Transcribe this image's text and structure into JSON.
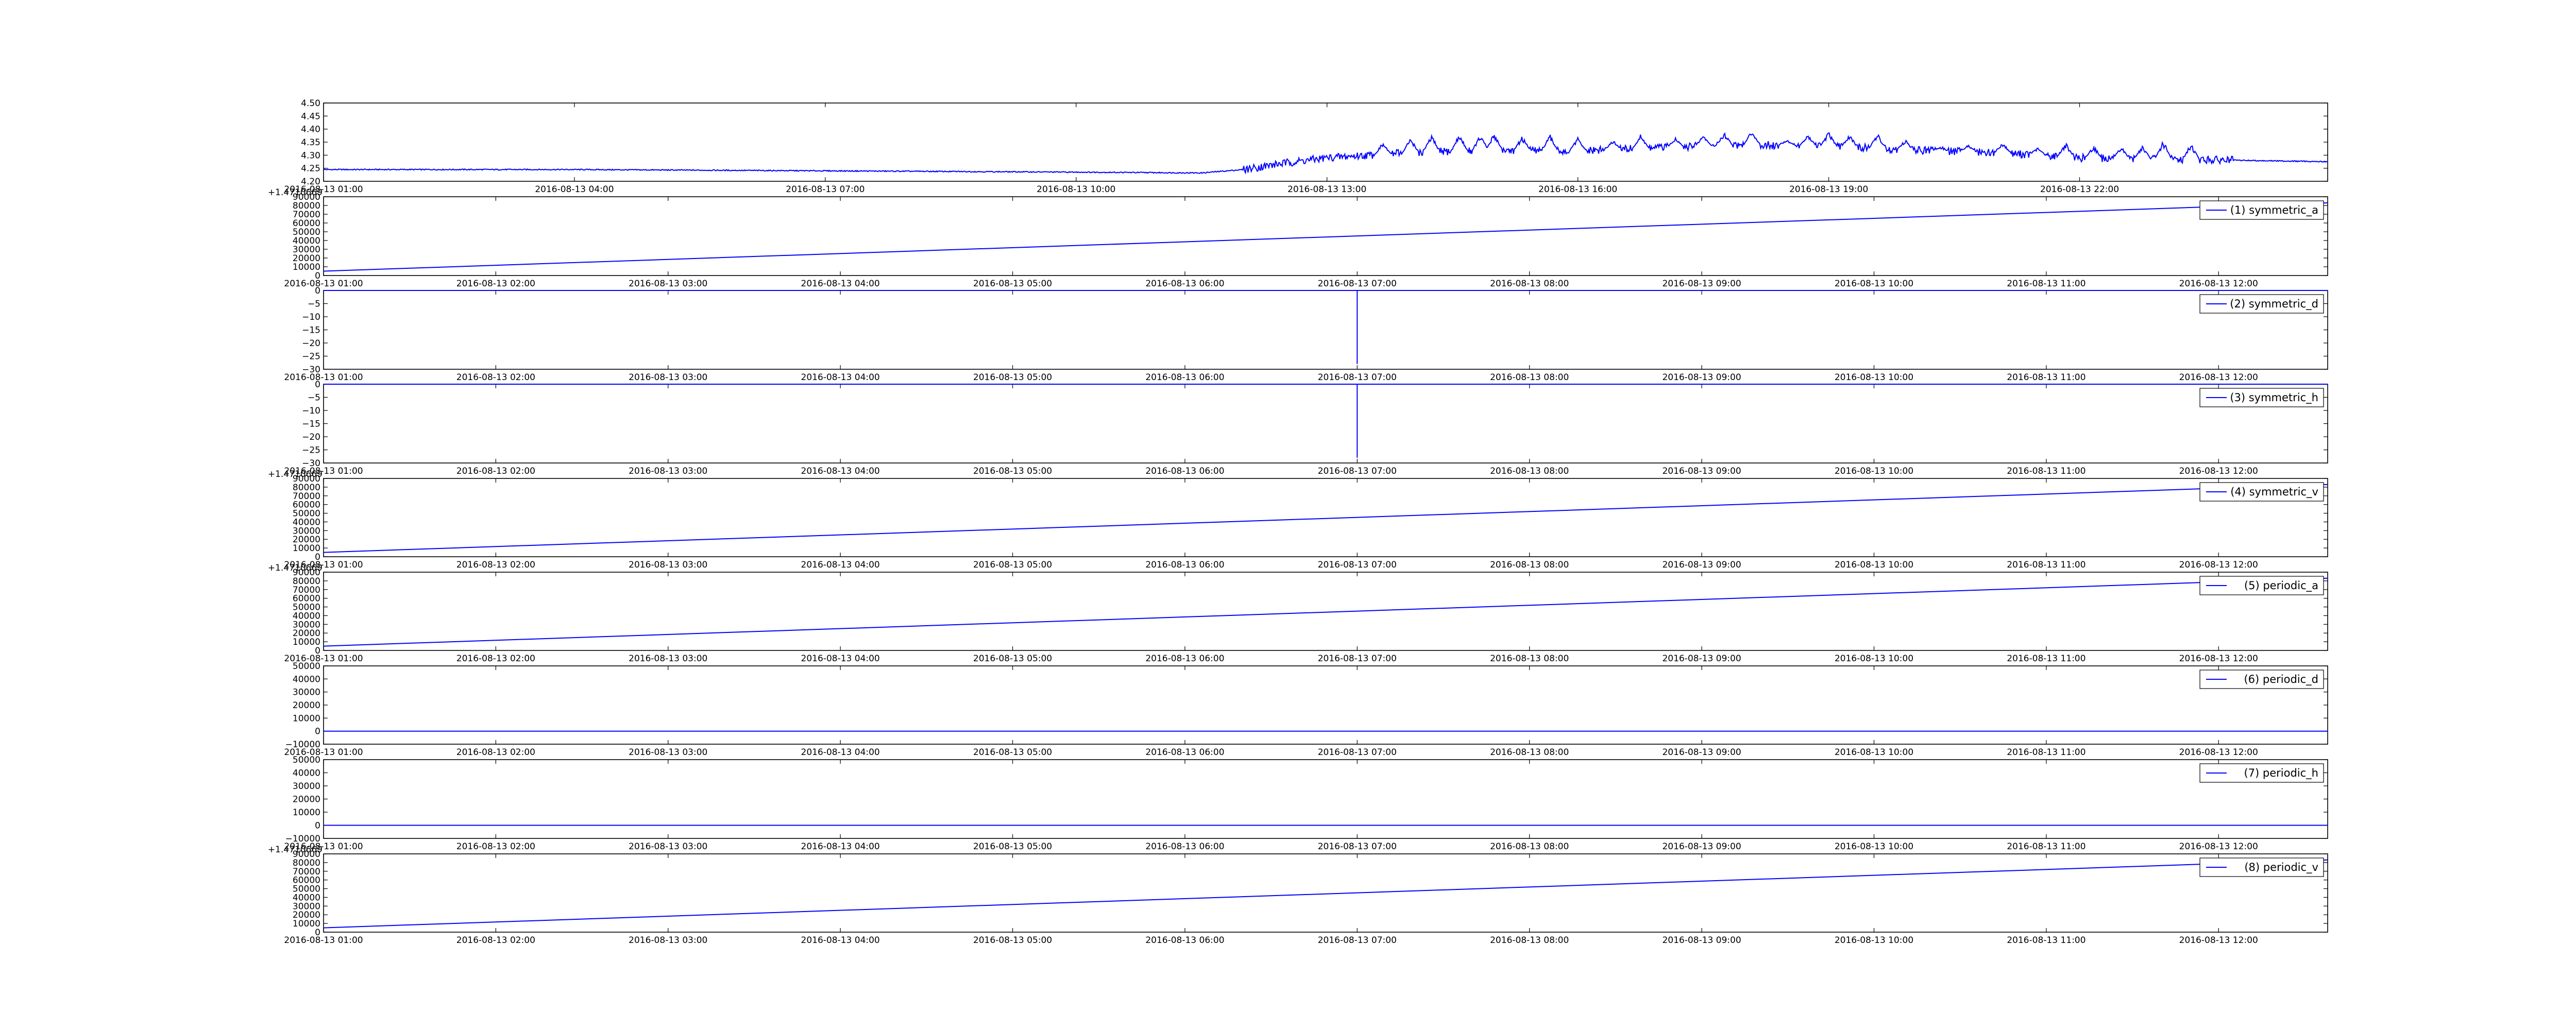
{
  "figure": {
    "background": "#ffffff",
    "line_color": "#0000ff"
  },
  "chart_data": [
    {
      "type": "line",
      "xlabel": "",
      "ylabel": "",
      "ylim": [
        4.2,
        4.5
      ],
      "y_ticks": [
        "4.20",
        "4.25",
        "4.30",
        "4.35",
        "4.40",
        "4.45",
        "4.50"
      ],
      "xlim": [
        "2016-08-13 01:00",
        "2016-08-14 00:58"
      ],
      "x_ticks": [
        "2016-08-13 01:00",
        "2016-08-13 04:00",
        "2016-08-13 07:00",
        "2016-08-13 10:00",
        "2016-08-13 13:00",
        "2016-08-13 16:00",
        "2016-08-13 19:00",
        "2016-08-13 22:00"
      ],
      "y_offset_text": "",
      "legend": null,
      "baseline": [
        [
          "2016-08-13 01:00",
          4.245
        ],
        [
          "2016-08-13 04:00",
          4.245
        ],
        [
          "2016-08-13 07:00",
          4.24
        ],
        [
          "2016-08-13 10:00",
          4.235
        ],
        [
          "2016-08-13 11:30",
          4.232
        ],
        [
          "2016-08-13 12:00",
          4.245
        ],
        [
          "2016-08-13 12:30",
          4.27
        ],
        [
          "2016-08-13 13:00",
          4.29
        ],
        [
          "2016-08-13 14:00",
          4.31
        ],
        [
          "2016-08-13 15:00",
          4.32
        ],
        [
          "2016-08-13 16:00",
          4.315
        ],
        [
          "2016-08-13 17:00",
          4.33
        ],
        [
          "2016-08-13 18:00",
          4.34
        ],
        [
          "2016-08-13 19:00",
          4.335
        ],
        [
          "2016-08-13 20:00",
          4.32
        ],
        [
          "2016-08-13 21:00",
          4.31
        ],
        [
          "2016-08-13 22:00",
          4.29
        ],
        [
          "2016-08-14 00:58",
          4.275
        ]
      ],
      "spikes": [
        [
          "2016-08-13 13:40",
          4.35
        ],
        [
          "2016-08-13 14:00",
          4.37
        ],
        [
          "2016-08-13 14:15",
          4.38
        ],
        [
          "2016-08-13 14:35",
          4.385
        ],
        [
          "2016-08-13 14:50",
          4.38
        ],
        [
          "2016-08-13 15:00",
          4.39
        ],
        [
          "2016-08-13 15:20",
          4.375
        ],
        [
          "2016-08-13 15:40",
          4.38
        ],
        [
          "2016-08-13 16:00",
          4.37
        ],
        [
          "2016-08-13 16:25",
          4.36
        ],
        [
          "2016-08-13 16:45",
          4.38
        ],
        [
          "2016-08-13 17:10",
          4.37
        ],
        [
          "2016-08-13 17:30",
          4.38
        ],
        [
          "2016-08-13 17:45",
          4.39
        ],
        [
          "2016-08-13 18:05",
          4.4
        ],
        [
          "2016-08-13 18:30",
          4.36
        ],
        [
          "2016-08-13 18:45",
          4.38
        ],
        [
          "2016-08-13 19:00",
          4.39
        ],
        [
          "2016-08-13 19:15",
          4.38
        ],
        [
          "2016-08-13 19:35",
          4.385
        ],
        [
          "2016-08-13 19:55",
          4.36
        ],
        [
          "2016-08-13 20:20",
          4.33
        ],
        [
          "2016-08-13 20:40",
          4.34
        ],
        [
          "2016-08-13 21:05",
          4.35
        ],
        [
          "2016-08-13 21:30",
          4.33
        ],
        [
          "2016-08-13 21:50",
          4.35
        ],
        [
          "2016-08-13 22:10",
          4.34
        ],
        [
          "2016-08-13 22:30",
          4.335
        ],
        [
          "2016-08-13 22:45",
          4.34
        ],
        [
          "2016-08-13 23:00",
          4.36
        ],
        [
          "2016-08-13 23:20",
          4.35
        ]
      ]
    },
    {
      "type": "line",
      "xlabel": "",
      "ylabel": "",
      "ylim": [
        0,
        90000
      ],
      "y_ticks": [
        "0",
        "10000",
        "20000",
        "30000",
        "40000",
        "50000",
        "60000",
        "70000",
        "80000",
        "90000"
      ],
      "xlim": [
        "2016-08-13 01:00",
        "2016-08-13 12:38"
      ],
      "x_ticks": [
        "2016-08-13 01:00",
        "2016-08-13 02:00",
        "2016-08-13 03:00",
        "2016-08-13 04:00",
        "2016-08-13 05:00",
        "2016-08-13 06:00",
        "2016-08-13 07:00",
        "2016-08-13 08:00",
        "2016-08-13 09:00",
        "2016-08-13 10:00",
        "2016-08-13 11:00",
        "2016-08-13 12:00"
      ],
      "y_offset_text": "+1.4710669",
      "legend": "(1) symmetric_a",
      "series": [
        {
          "name": "(1) symmetric_a",
          "x": [
            "2016-08-13 01:00",
            "2016-08-13 12:38"
          ],
          "y": [
            5000,
            83000
          ]
        }
      ]
    },
    {
      "type": "line",
      "xlabel": "",
      "ylabel": "",
      "ylim": [
        -30,
        0
      ],
      "y_ticks": [
        "−30",
        "−25",
        "−20",
        "−15",
        "−10",
        "−5",
        "0"
      ],
      "xlim": [
        "2016-08-13 01:00",
        "2016-08-13 12:38"
      ],
      "x_ticks": [
        "2016-08-13 01:00",
        "2016-08-13 02:00",
        "2016-08-13 03:00",
        "2016-08-13 04:00",
        "2016-08-13 05:00",
        "2016-08-13 06:00",
        "2016-08-13 07:00",
        "2016-08-13 08:00",
        "2016-08-13 09:00",
        "2016-08-13 10:00",
        "2016-08-13 11:00",
        "2016-08-13 12:00"
      ],
      "y_offset_text": "",
      "legend": "(2) symmetric_d",
      "series": [
        {
          "name": "(2) symmetric_d",
          "x": [
            "2016-08-13 01:00",
            "2016-08-13 07:00",
            "2016-08-13 07:00",
            "2016-08-13 07:00",
            "2016-08-13 12:38"
          ],
          "y": [
            0,
            0,
            -28,
            0,
            0
          ]
        }
      ]
    },
    {
      "type": "line",
      "xlabel": "",
      "ylabel": "",
      "ylim": [
        -30,
        0
      ],
      "y_ticks": [
        "−30",
        "−25",
        "−20",
        "−15",
        "−10",
        "−5",
        "0"
      ],
      "xlim": [
        "2016-08-13 01:00",
        "2016-08-13 12:38"
      ],
      "x_ticks": [
        "2016-08-13 01:00",
        "2016-08-13 02:00",
        "2016-08-13 03:00",
        "2016-08-13 04:00",
        "2016-08-13 05:00",
        "2016-08-13 06:00",
        "2016-08-13 07:00",
        "2016-08-13 08:00",
        "2016-08-13 09:00",
        "2016-08-13 10:00",
        "2016-08-13 11:00",
        "2016-08-13 12:00"
      ],
      "y_offset_text": "",
      "legend": "(3) symmetric_h",
      "series": [
        {
          "name": "(3) symmetric_h",
          "x": [
            "2016-08-13 01:00",
            "2016-08-13 07:00",
            "2016-08-13 07:00",
            "2016-08-13 07:00",
            "2016-08-13 12:38"
          ],
          "y": [
            0,
            0,
            -28,
            0,
            0
          ]
        }
      ]
    },
    {
      "type": "line",
      "xlabel": "",
      "ylabel": "",
      "ylim": [
        0,
        90000
      ],
      "y_ticks": [
        "0",
        "10000",
        "20000",
        "30000",
        "40000",
        "50000",
        "60000",
        "70000",
        "80000",
        "90000"
      ],
      "xlim": [
        "2016-08-13 01:00",
        "2016-08-13 12:38"
      ],
      "x_ticks": [
        "2016-08-13 01:00",
        "2016-08-13 02:00",
        "2016-08-13 03:00",
        "2016-08-13 04:00",
        "2016-08-13 05:00",
        "2016-08-13 06:00",
        "2016-08-13 07:00",
        "2016-08-13 08:00",
        "2016-08-13 09:00",
        "2016-08-13 10:00",
        "2016-08-13 11:00",
        "2016-08-13 12:00"
      ],
      "y_offset_text": "+1.4710669",
      "legend": "(4) symmetric_v",
      "series": [
        {
          "name": "(4) symmetric_v",
          "x": [
            "2016-08-13 01:00",
            "2016-08-13 12:38"
          ],
          "y": [
            5000,
            83000
          ]
        }
      ]
    },
    {
      "type": "line",
      "xlabel": "",
      "ylabel": "",
      "ylim": [
        0,
        90000
      ],
      "y_ticks": [
        "0",
        "10000",
        "20000",
        "30000",
        "40000",
        "50000",
        "60000",
        "70000",
        "80000",
        "90000"
      ],
      "xlim": [
        "2016-08-13 01:00",
        "2016-08-13 12:38"
      ],
      "x_ticks": [
        "2016-08-13 01:00",
        "2016-08-13 02:00",
        "2016-08-13 03:00",
        "2016-08-13 04:00",
        "2016-08-13 05:00",
        "2016-08-13 06:00",
        "2016-08-13 07:00",
        "2016-08-13 08:00",
        "2016-08-13 09:00",
        "2016-08-13 10:00",
        "2016-08-13 11:00",
        "2016-08-13 12:00"
      ],
      "y_offset_text": "+1.4710669",
      "legend": "(5) periodic_a",
      "series": [
        {
          "name": "(5) periodic_a",
          "x": [
            "2016-08-13 01:00",
            "2016-08-13 12:38"
          ],
          "y": [
            5000,
            83000
          ]
        }
      ]
    },
    {
      "type": "line",
      "xlabel": "",
      "ylabel": "",
      "ylim": [
        -10000,
        50000
      ],
      "y_ticks": [
        "−10000",
        "0",
        "10000",
        "20000",
        "30000",
        "40000",
        "50000"
      ],
      "xlim": [
        "2016-08-13 01:00",
        "2016-08-13 12:38"
      ],
      "x_ticks": [
        "2016-08-13 01:00",
        "2016-08-13 02:00",
        "2016-08-13 03:00",
        "2016-08-13 04:00",
        "2016-08-13 05:00",
        "2016-08-13 06:00",
        "2016-08-13 07:00",
        "2016-08-13 08:00",
        "2016-08-13 09:00",
        "2016-08-13 10:00",
        "2016-08-13 11:00",
        "2016-08-13 12:00"
      ],
      "y_offset_text": "",
      "legend": "(6) periodic_d",
      "series": [
        {
          "name": "(6) periodic_d",
          "x": [
            "2016-08-13 01:00",
            "2016-08-13 12:38"
          ],
          "y": [
            0,
            0
          ]
        }
      ]
    },
    {
      "type": "line",
      "xlabel": "",
      "ylabel": "",
      "ylim": [
        -10000,
        50000
      ],
      "y_ticks": [
        "−10000",
        "0",
        "10000",
        "20000",
        "30000",
        "40000",
        "50000"
      ],
      "xlim": [
        "2016-08-13 01:00",
        "2016-08-13 12:38"
      ],
      "x_ticks": [
        "2016-08-13 01:00",
        "2016-08-13 02:00",
        "2016-08-13 03:00",
        "2016-08-13 04:00",
        "2016-08-13 05:00",
        "2016-08-13 06:00",
        "2016-08-13 07:00",
        "2016-08-13 08:00",
        "2016-08-13 09:00",
        "2016-08-13 10:00",
        "2016-08-13 11:00",
        "2016-08-13 12:00"
      ],
      "y_offset_text": "",
      "legend": "(7) periodic_h",
      "series": [
        {
          "name": "(7) periodic_h",
          "x": [
            "2016-08-13 01:00",
            "2016-08-13 12:38"
          ],
          "y": [
            0,
            0
          ]
        }
      ]
    },
    {
      "type": "line",
      "xlabel": "",
      "ylabel": "",
      "ylim": [
        0,
        90000
      ],
      "y_ticks": [
        "0",
        "10000",
        "20000",
        "30000",
        "40000",
        "50000",
        "60000",
        "70000",
        "80000",
        "90000"
      ],
      "xlim": [
        "2016-08-13 01:00",
        "2016-08-13 12:38"
      ],
      "x_ticks": [
        "2016-08-13 01:00",
        "2016-08-13 02:00",
        "2016-08-13 03:00",
        "2016-08-13 04:00",
        "2016-08-13 05:00",
        "2016-08-13 06:00",
        "2016-08-13 07:00",
        "2016-08-13 08:00",
        "2016-08-13 09:00",
        "2016-08-13 10:00",
        "2016-08-13 11:00",
        "2016-08-13 12:00"
      ],
      "y_offset_text": "+1.4710669",
      "legend": "(8) periodic_v",
      "series": [
        {
          "name": "(8) periodic_v",
          "x": [
            "2016-08-13 01:00",
            "2016-08-13 12:38"
          ],
          "y": [
            5000,
            83000
          ]
        }
      ]
    }
  ]
}
